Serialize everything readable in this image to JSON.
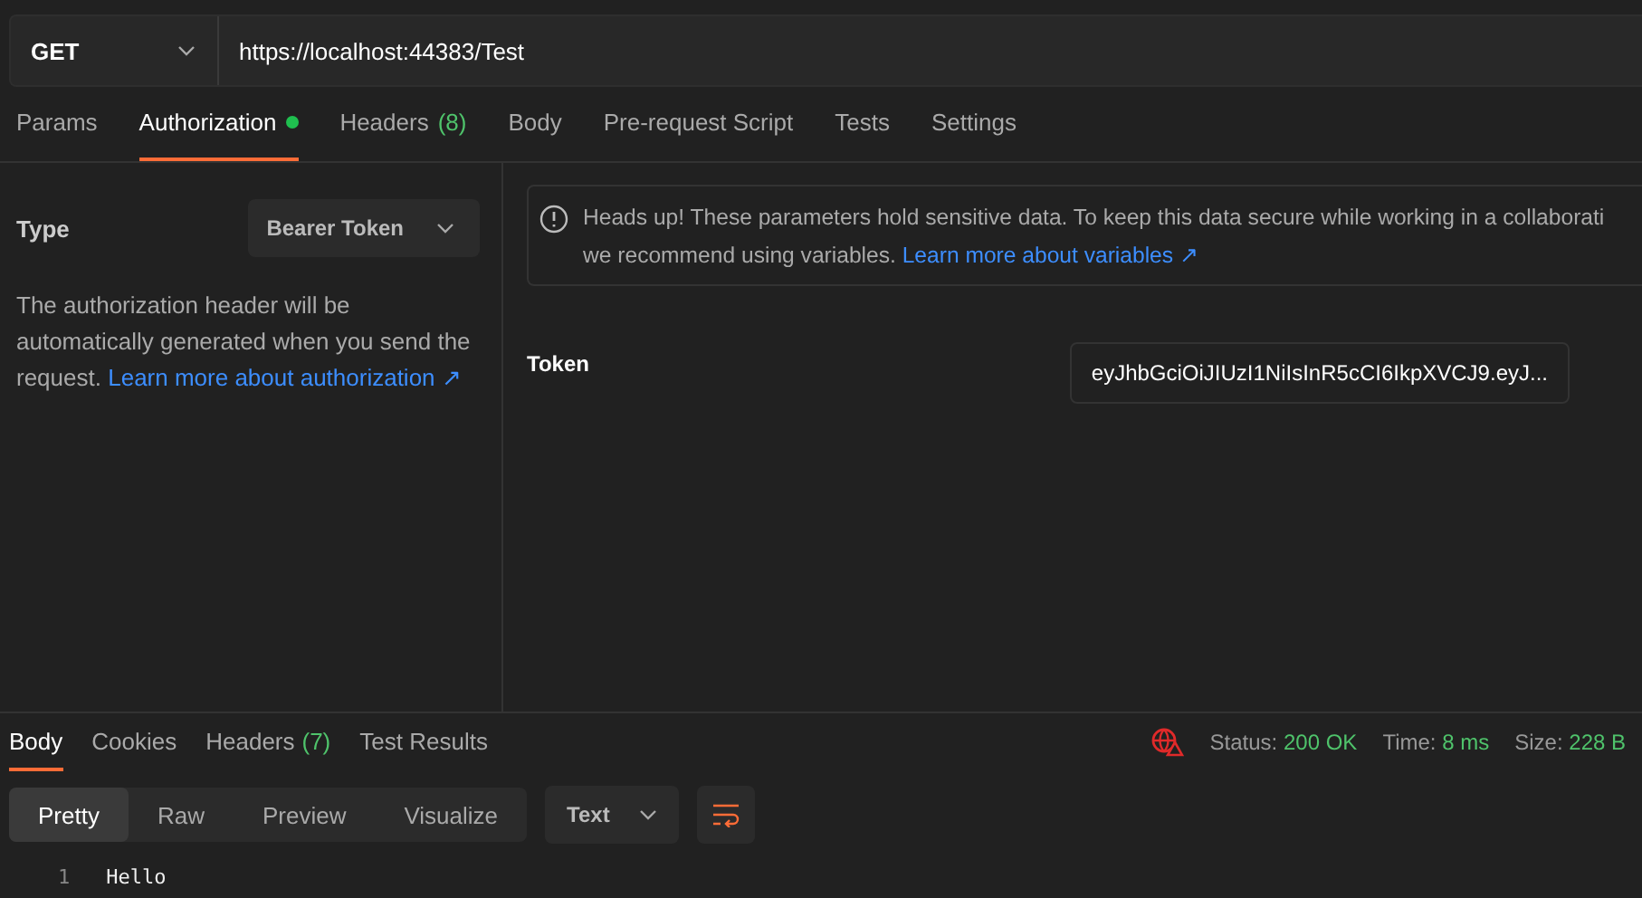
{
  "request": {
    "method": "GET",
    "url": "https://localhost:44383/Test"
  },
  "tabs": [
    {
      "label": "Params",
      "selected": false
    },
    {
      "label": "Authorization",
      "selected": true,
      "dot": true
    },
    {
      "label": "Headers",
      "count": "(8)",
      "selected": false
    },
    {
      "label": "Body",
      "selected": false
    },
    {
      "label": "Pre-request Script",
      "selected": false
    },
    {
      "label": "Tests",
      "selected": false
    },
    {
      "label": "Settings",
      "selected": false
    }
  ],
  "auth": {
    "type_label": "Type",
    "type_value": "Bearer Token",
    "description": "The authorization header will be automatically generated when you send the request.",
    "description_link": "Learn more about authorization ↗",
    "notice": "Heads up! These parameters hold sensitive data. To keep this data secure while working in a collaborati\nwe recommend using variables.",
    "notice_link": "Learn more about variables ↗",
    "token_label": "Token",
    "token_value": "eyJhbGciOiJIUzI1NiIsInR5cCI6IkpXVCJ9.eyJ..."
  },
  "response_tabs": [
    {
      "label": "Body",
      "selected": true
    },
    {
      "label": "Cookies",
      "selected": false
    },
    {
      "label": "Headers",
      "count": "(7)",
      "selected": false
    },
    {
      "label": "Test Results",
      "selected": false
    }
  ],
  "status": [
    {
      "label": "Status:",
      "value": "200 OK"
    },
    {
      "label": "Time:",
      "value": "8 ms"
    },
    {
      "label": "Size:",
      "value": "228 B"
    }
  ],
  "view_modes": [
    {
      "label": "Pretty",
      "selected": true
    },
    {
      "label": "Raw",
      "selected": false
    },
    {
      "label": "Preview",
      "selected": false
    },
    {
      "label": "Visualize",
      "selected": false
    }
  ],
  "format": "Text",
  "body_lines": [
    {
      "number": "1",
      "text": "Hello"
    }
  ]
}
